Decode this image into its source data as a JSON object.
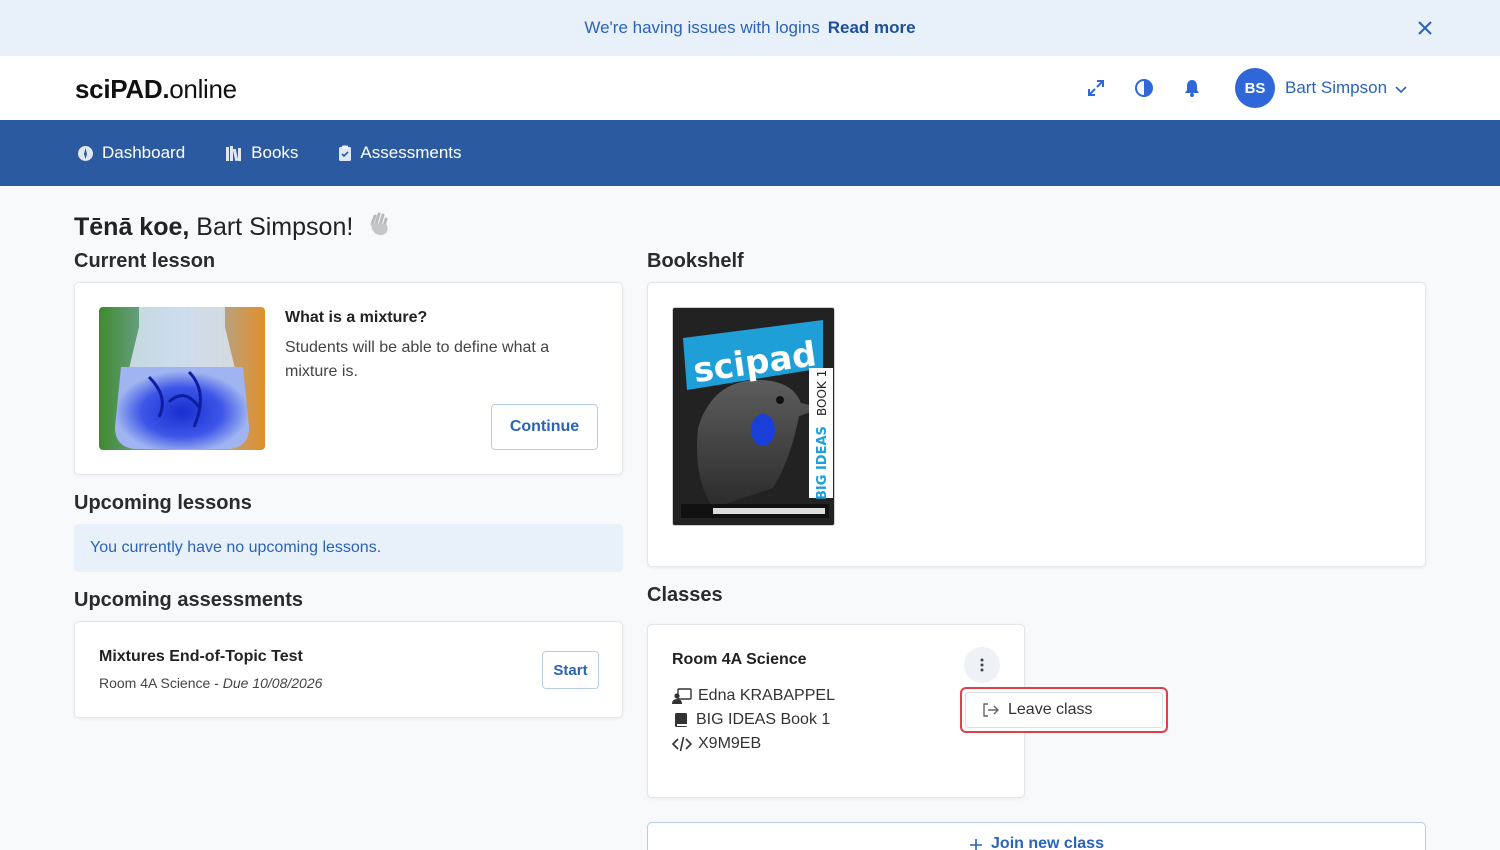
{
  "banner": {
    "message": "We're having issues with logins",
    "link": "Read more"
  },
  "header": {
    "logo_bold": "sciPAD",
    "logo_dot": ".",
    "logo_rest": "online",
    "user": {
      "initials": "BS",
      "name": "Bart Simpson"
    },
    "icons": [
      "expand-icon",
      "contrast-icon",
      "bell-icon",
      "chevron-down-icon"
    ]
  },
  "nav": {
    "items": [
      {
        "label": "Dashboard",
        "icon": "compass-icon"
      },
      {
        "label": "Books",
        "icon": "books-icon"
      },
      {
        "label": "Assessments",
        "icon": "clipboard-icon"
      }
    ]
  },
  "greeting": {
    "salutation": "Tēnā koe,",
    "name": "Bart Simpson!"
  },
  "current_lesson": {
    "heading": "Current lesson",
    "title": "What is a mixture?",
    "description": "Students will be able to define what a mixture is.",
    "button": "Continue"
  },
  "upcoming_lessons": {
    "heading": "Upcoming lessons",
    "empty": "You currently have no upcoming lessons."
  },
  "upcoming_assessments": {
    "heading": "Upcoming assessments",
    "items": [
      {
        "title": "Mixtures End-of-Topic Test",
        "class": "Room 4A Science",
        "separator": " - ",
        "due": "Due 10/08/2026",
        "button": "Start"
      }
    ]
  },
  "bookshelf": {
    "heading": "Bookshelf",
    "book": {
      "brand": "scipad",
      "title_main": "BIG IDEAS",
      "title_sub": "BOOK 1"
    }
  },
  "classes": {
    "heading": "Classes",
    "items": [
      {
        "name": "Room 4A Science",
        "teacher": "Edna KRABAPPEL",
        "book": "BIG IDEAS Book 1",
        "code": "X9M9EB"
      }
    ],
    "menu": {
      "leave": "Leave class"
    },
    "join": "Join new class"
  },
  "colors": {
    "primary": "#2c5aa0",
    "accent": "#2a63b8",
    "highlight": "#e0404a"
  }
}
